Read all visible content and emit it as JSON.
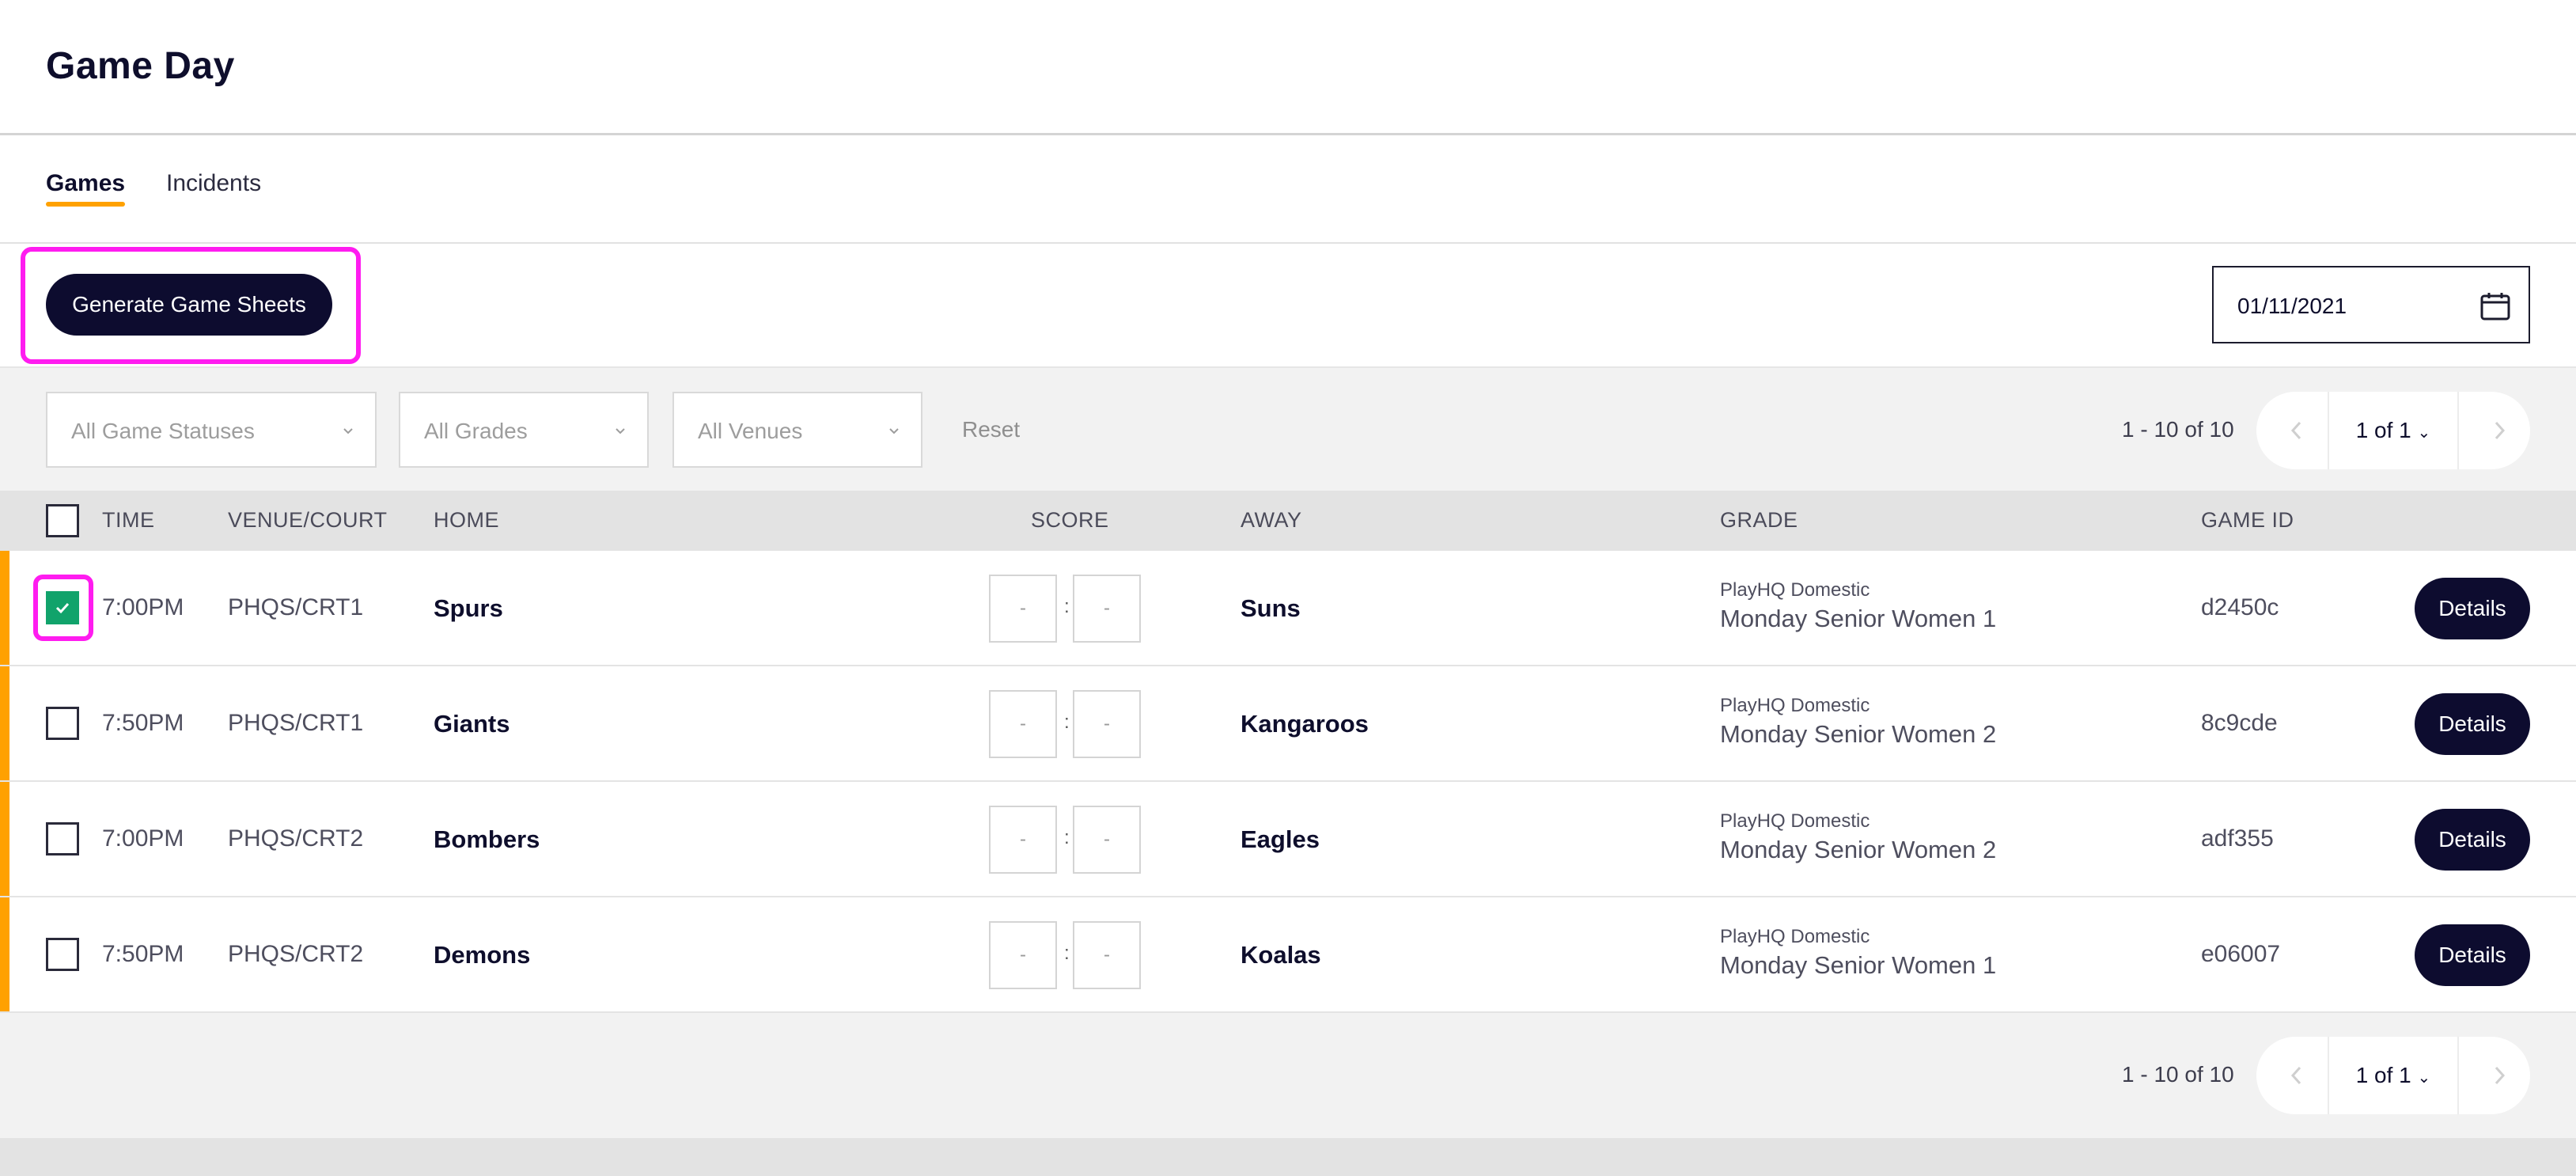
{
  "header": {
    "title": "Game Day"
  },
  "tabs": [
    {
      "label": "Games",
      "active": true
    },
    {
      "label": "Incidents",
      "active": false
    }
  ],
  "toolbar": {
    "generate_label": "Generate Game Sheets",
    "date_value": "01/11/2021",
    "date_icon": "calendar-icon"
  },
  "filters": {
    "status": "All Game Statuses",
    "grades": "All Grades",
    "venues": "All Venues",
    "reset_label": "Reset"
  },
  "pagination": {
    "count": "1 - 10 of 10",
    "page": "1 of 1"
  },
  "table": {
    "columns": {
      "time": "TIME",
      "venue": "VENUE/COURT",
      "home": "HOME",
      "score": "SCORE",
      "away": "AWAY",
      "grade": "GRADE",
      "game_id": "GAME ID"
    },
    "score_placeholder": "-",
    "score_separator": ":",
    "details_label": "Details",
    "rows": [
      {
        "checked": true,
        "time": "7:00PM",
        "venue": "PHQS/CRT1",
        "home": "Spurs",
        "away": "Suns",
        "grade_org": "PlayHQ Domestic",
        "grade": "Monday Senior Women 1",
        "game_id": "d2450c"
      },
      {
        "checked": false,
        "time": "7:50PM",
        "venue": "PHQS/CRT1",
        "home": "Giants",
        "away": "Kangaroos",
        "grade_org": "PlayHQ Domestic",
        "grade": "Monday Senior Women 2",
        "game_id": "8c9cde"
      },
      {
        "checked": false,
        "time": "7:00PM",
        "venue": "PHQS/CRT2",
        "home": "Bombers",
        "away": "Eagles",
        "grade_org": "PlayHQ Domestic",
        "grade": "Monday Senior Women 2",
        "game_id": "adf355"
      },
      {
        "checked": false,
        "time": "7:50PM",
        "venue": "PHQS/CRT2",
        "home": "Demons",
        "away": "Koalas",
        "grade_org": "PlayHQ Domestic",
        "grade": "Monday Senior Women 1",
        "game_id": "e06007"
      }
    ]
  },
  "colors": {
    "primary": "#0d0c2f",
    "accent": "#ffa100",
    "highlight": "#ff1cf0",
    "checked": "#11a36b"
  }
}
